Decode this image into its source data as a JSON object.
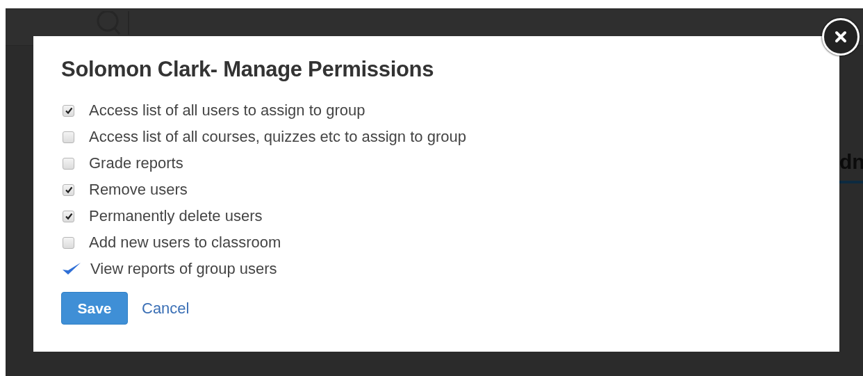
{
  "background": {
    "partial_text": "dn"
  },
  "dialog": {
    "title": "Solomon Clark- Manage Permissions",
    "permissions": [
      {
        "kind": "checkbox",
        "label": "Access list of all users to assign to group",
        "checked": true
      },
      {
        "kind": "checkbox",
        "label": "Access list of all courses, quizzes etc to assign to group",
        "checked": false
      },
      {
        "kind": "checkbox",
        "label": "Grade reports",
        "checked": false
      },
      {
        "kind": "checkbox",
        "label": "Remove users",
        "checked": true
      },
      {
        "kind": "checkbox",
        "label": "Permanently delete users",
        "checked": true
      },
      {
        "kind": "checkbox",
        "label": "Add new users to classroom",
        "checked": false
      },
      {
        "kind": "tick",
        "label": "View reports of group users",
        "checked": true
      }
    ],
    "buttons": [
      {
        "kind": "primary",
        "label": "Save"
      },
      {
        "kind": "link",
        "label": "Cancel"
      }
    ]
  }
}
